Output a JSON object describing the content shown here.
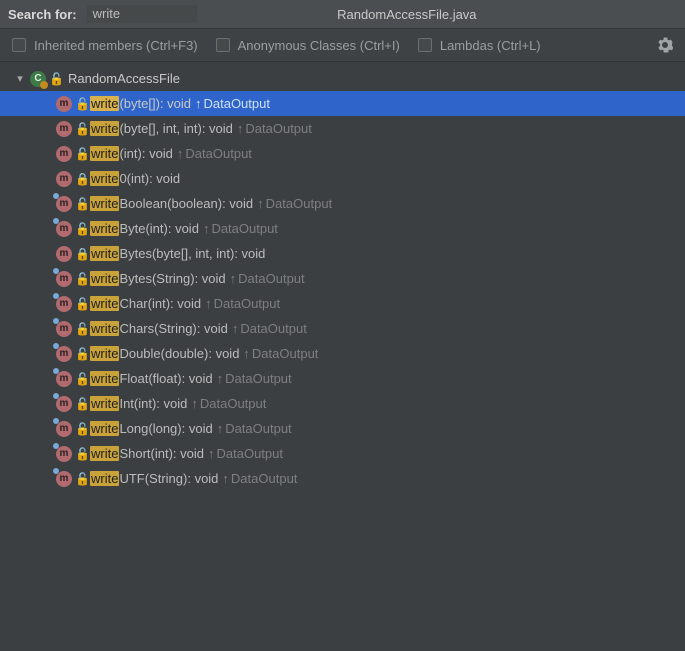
{
  "header": {
    "search_label": "Search for:",
    "search_value": "write",
    "title": "RandomAccessFile.java"
  },
  "filters": {
    "inherited": "Inherited members (Ctrl+F3)",
    "anonymous": "Anonymous Classes (Ctrl+I)",
    "lambdas": "Lambdas (Ctrl+L)"
  },
  "classNode": {
    "name": "RandomAccessFile",
    "letter": "C"
  },
  "methods": [
    {
      "hl": "write",
      "sig": "(byte[]): void",
      "inherit": "DataOutput",
      "selected": true,
      "impl": false,
      "lock": "ilock"
    },
    {
      "hl": "write",
      "sig": "(byte[], int, int): void",
      "inherit": "DataOutput",
      "selected": false,
      "impl": false,
      "lock": "ilock"
    },
    {
      "hl": "write",
      "sig": "(int): void",
      "inherit": "DataOutput",
      "selected": false,
      "impl": false,
      "lock": "ilock"
    },
    {
      "hl": "write",
      "sig": "0(int): void",
      "inherit": "",
      "selected": false,
      "impl": false,
      "lock": "lock"
    },
    {
      "hl": "write",
      "sig": "Boolean(boolean): void",
      "inherit": "DataOutput",
      "selected": false,
      "impl": true,
      "lock": "ilock"
    },
    {
      "hl": "write",
      "sig": "Byte(int): void",
      "inherit": "DataOutput",
      "selected": false,
      "impl": true,
      "lock": "ilock"
    },
    {
      "hl": "write",
      "sig": "Bytes(byte[], int, int): void",
      "inherit": "",
      "selected": false,
      "impl": false,
      "lock": "lock"
    },
    {
      "hl": "write",
      "sig": "Bytes(String): void",
      "inherit": "DataOutput",
      "selected": false,
      "impl": true,
      "lock": "ilock"
    },
    {
      "hl": "write",
      "sig": "Char(int): void",
      "inherit": "DataOutput",
      "selected": false,
      "impl": true,
      "lock": "ilock"
    },
    {
      "hl": "write",
      "sig": "Chars(String): void",
      "inherit": "DataOutput",
      "selected": false,
      "impl": true,
      "lock": "ilock"
    },
    {
      "hl": "write",
      "sig": "Double(double): void",
      "inherit": "DataOutput",
      "selected": false,
      "impl": true,
      "lock": "ilock"
    },
    {
      "hl": "write",
      "sig": "Float(float): void",
      "inherit": "DataOutput",
      "selected": false,
      "impl": true,
      "lock": "ilock"
    },
    {
      "hl": "write",
      "sig": "Int(int): void",
      "inherit": "DataOutput",
      "selected": false,
      "impl": true,
      "lock": "ilock"
    },
    {
      "hl": "write",
      "sig": "Long(long): void",
      "inherit": "DataOutput",
      "selected": false,
      "impl": true,
      "lock": "ilock"
    },
    {
      "hl": "write",
      "sig": "Short(int): void",
      "inherit": "DataOutput",
      "selected": false,
      "impl": true,
      "lock": "ilock"
    },
    {
      "hl": "write",
      "sig": "UTF(String): void",
      "inherit": "DataOutput",
      "selected": false,
      "impl": true,
      "lock": "ilock"
    }
  ]
}
